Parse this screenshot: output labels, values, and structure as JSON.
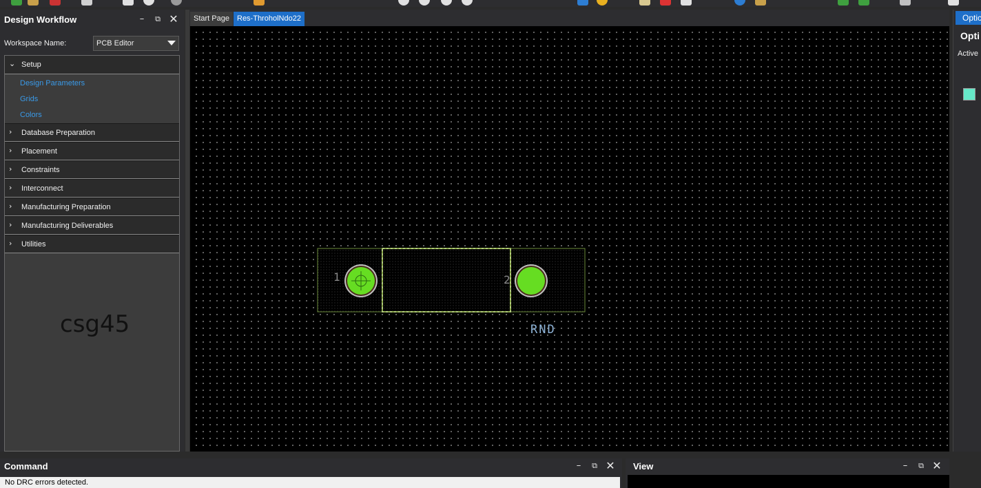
{
  "design_workflow": {
    "title": "Design Workflow",
    "workspace_label": "Workspace Name:",
    "workspace_value": "PCB Editor",
    "setup": {
      "label": "Setup",
      "items": [
        "Design Parameters",
        "Grids",
        "Colors"
      ]
    },
    "sections": [
      "Database Preparation",
      "Placement",
      "Constraints",
      "Interconnect",
      "Manufacturing Preparation",
      "Manufacturing Deliverables",
      "Utilities"
    ],
    "watermark": "csg45"
  },
  "tabs": {
    "start": "Start Page",
    "document": "Res-ThroholNdo22"
  },
  "canvas": {
    "pin1_label": "1",
    "pin2_label": "2",
    "ref_label": "RND"
  },
  "options_panel": {
    "tab_label": "Optic",
    "title": "Opti",
    "active_label": "Active"
  },
  "command": {
    "title": "Command",
    "output": "No DRC errors detected."
  },
  "view": {
    "title": "View"
  },
  "colors": {
    "accent": "#1e6fc9",
    "pad_fill": "#66dd22",
    "outline": "#6b8c3a",
    "swatch": "#66e8c8",
    "link": "#3a9ae8"
  }
}
